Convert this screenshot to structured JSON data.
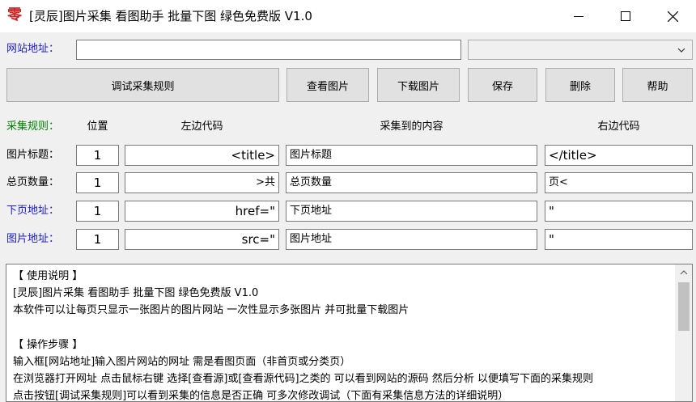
{
  "window": {
    "title": "[灵辰]图片采集 看图助手 批量下图 绿色免费版 V1.0",
    "app_icon_glyph": "零"
  },
  "url_row": {
    "label": "网站地址：",
    "url_value": "",
    "dropdown_value": ""
  },
  "toolbar": {
    "debug_label": "调试采集规则",
    "view_label": "查看图片",
    "download_label": "下载图片",
    "save_label": "保存",
    "delete_label": "删除",
    "help_label": "帮助"
  },
  "rules": {
    "section_label": "采集规则：",
    "headers": {
      "position": "位置",
      "left_code": "左边代码",
      "content": "采集到的内容",
      "right_code": "右边代码"
    },
    "rows": [
      {
        "label": "图片标题：",
        "position": "1",
        "left": "<title>",
        "content": "图片标题",
        "right": "</title>"
      },
      {
        "label": "总页数量：",
        "position": "1",
        "left": ">共",
        "content": "总页数量",
        "right": "页<"
      },
      {
        "label": "下页地址：",
        "position": "1",
        "left": "href=\"",
        "content": "下页地址",
        "right": "\""
      },
      {
        "label": "图片地址：",
        "position": "1",
        "left": "src=\"",
        "content": "图片地址",
        "right": "\""
      }
    ]
  },
  "instructions": {
    "lines": [
      "【 使用说明 】",
      "[灵辰]图片采集 看图助手 批量下图 绿色免费版 V1.0",
      "本软件可以让每页只显示一张图片的图片网站 一次性显示多张图片 并可批量下载图片",
      "",
      "【 操作步骤 】",
      "输入框[网站地址]输入图片网站的网址 需是看图页面（非首页或分类页）",
      "在浏览器打开网址 点击鼠标右键 选择[查看源]或[查看源代码]之类的 可以看到网站的源码 然后分析 以便填写下面的采集规则",
      "点击按钮[调试采集规则]可以看到采集的信息是否正确 可多次修改调试（下面有采集信息方法的详细说明）"
    ]
  },
  "colors": {
    "label_blue": "#1a1ad0",
    "label_green": "#008000",
    "icon_red": "#c62828"
  }
}
